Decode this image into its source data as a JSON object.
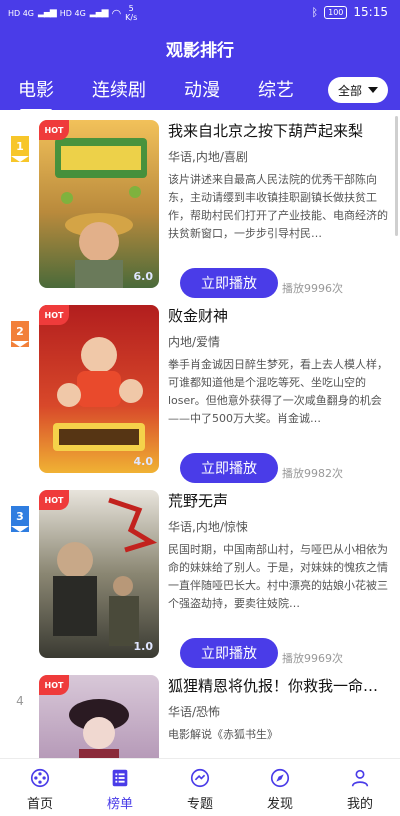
{
  "status": {
    "sim1": "HD 4G",
    "sim2": "HD 4G",
    "speed_value": "5",
    "speed_unit": "K/s",
    "battery": "100",
    "time": "15:15"
  },
  "header": {
    "title": "观影排行"
  },
  "tabs": [
    {
      "label": "电影"
    },
    {
      "label": "连续剧"
    },
    {
      "label": "动漫"
    },
    {
      "label": "综艺"
    }
  ],
  "filter": {
    "selected": "全部"
  },
  "movies": [
    {
      "rank": "1",
      "hot": "HOT",
      "score": "6.0",
      "title": "我来自北京之按下葫芦起来梨",
      "tags": "华语,内地/喜剧",
      "desc": "该片讲述来自最高人民法院的优秀干部陈向东，主动请缨到丰收镇挂职副镇长做扶贫工作，帮助村民们打开了产业技能、电商经济的扶贫新窗口，一步步引导村民…",
      "play_label": "立即播放",
      "plays": "播放9996次"
    },
    {
      "rank": "2",
      "hot": "HOT",
      "score": "4.0",
      "title": "败金财神",
      "tags": "内地/爱情",
      "desc": "拳手肖金诚因日醉生梦死，看上去人模人样，可谁都知道他是个混吃等死、坐吃山空的loser。但他意外获得了一次咸鱼翻身的机会——中了500万大奖。肖金诚…",
      "play_label": "立即播放",
      "plays": "播放9982次"
    },
    {
      "rank": "3",
      "hot": "HOT",
      "score": "1.0",
      "title": "荒野无声",
      "tags": "华语,内地/惊悚",
      "desc": "民国时期，中国南部山村，与哑巴从小相依为命的妹妹给了别人。于是，对妹妹的愧疚之情一直伴随哑巴长大。村中漂亮的姑娘小花被三个强盗劫持，要卖往妓院…",
      "play_label": "立即播放",
      "plays": "播放9969次"
    },
    {
      "rank": "4",
      "hot": "HOT",
      "score": "",
      "title": "狐狸精恩将仇报！你救我一命…",
      "tags": "华语/恐怖",
      "desc": "电影解说《赤狐书生》",
      "play_label": "",
      "plays": ""
    }
  ],
  "bottom_nav": [
    {
      "label": "首页",
      "icon": "film-reel-icon"
    },
    {
      "label": "榜单",
      "icon": "ranking-list-icon"
    },
    {
      "label": "专题",
      "icon": "topic-arrow-icon"
    },
    {
      "label": "发现",
      "icon": "discover-compass-icon"
    },
    {
      "label": "我的",
      "icon": "profile-user-icon"
    }
  ],
  "colors": {
    "accent": "#4a3ce8",
    "hot": "#ef3b3b",
    "rank1": "#f7c62a",
    "rank2": "#f2803a",
    "rank3": "#2f7de0"
  }
}
